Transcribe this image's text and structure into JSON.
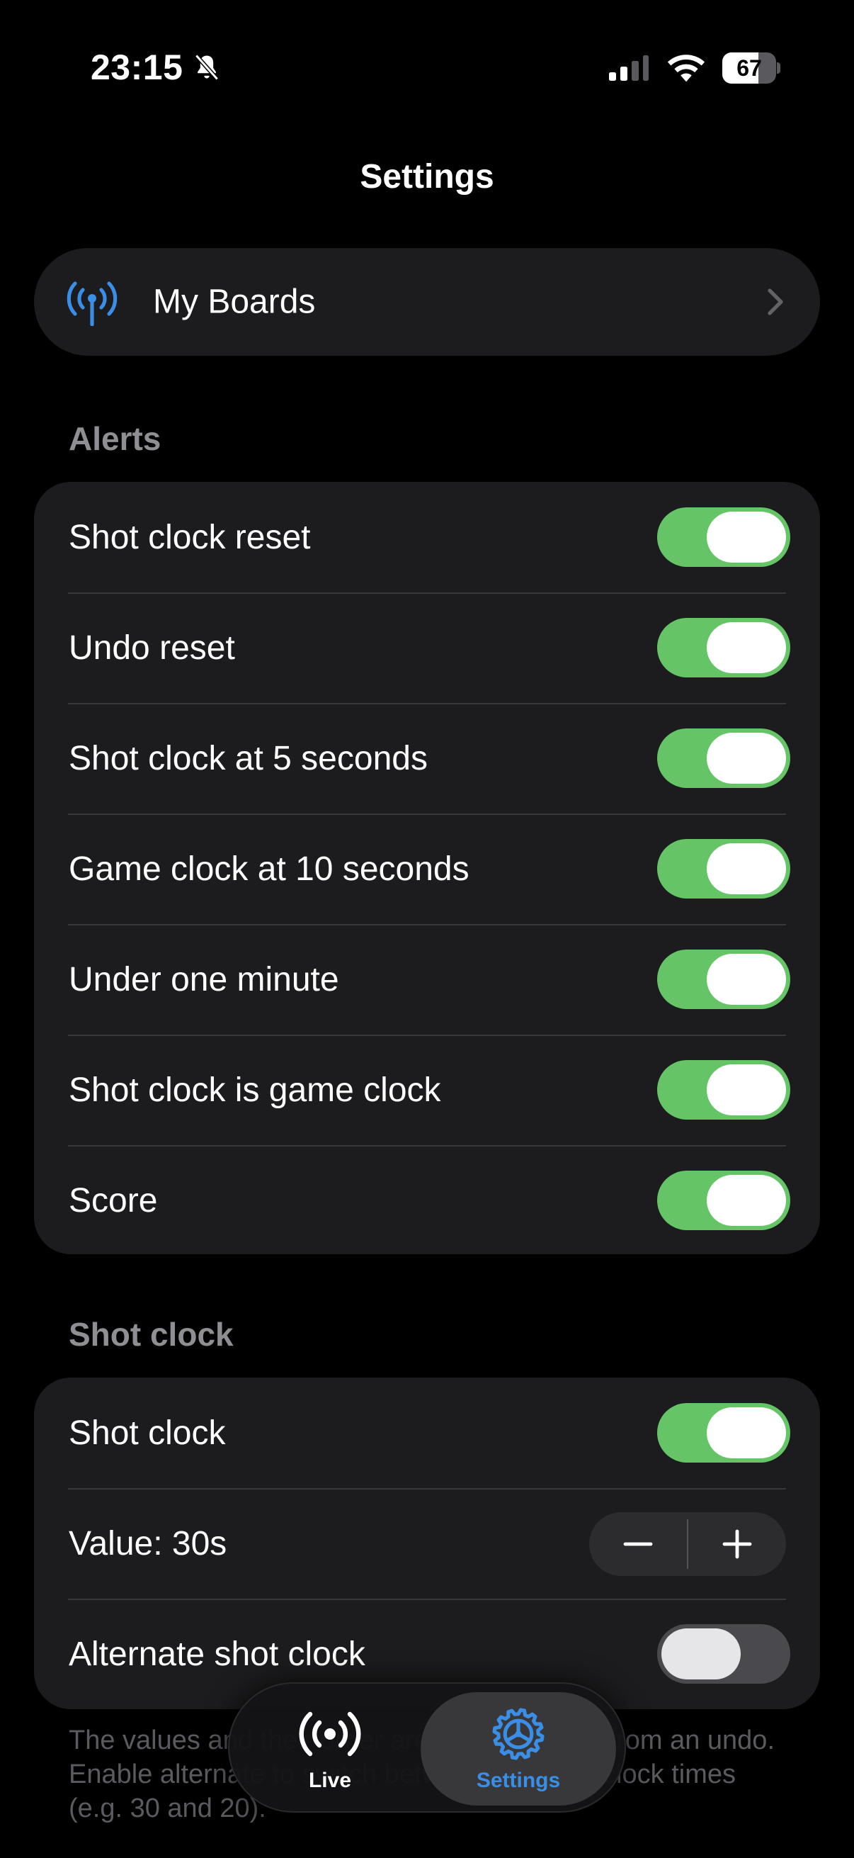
{
  "status_bar": {
    "time": "23:15",
    "battery_percent": 67,
    "battery_label": "67",
    "icons": [
      "bell-slash-icon",
      "cellular-signal-icon",
      "wifi-icon",
      "battery-icon"
    ]
  },
  "nav": {
    "title": "Settings"
  },
  "boards": {
    "label": "My Boards",
    "icon": "antenna-icon",
    "accent": "#3a8ee6"
  },
  "alerts": {
    "header": "Alerts",
    "items": [
      {
        "label": "Shot clock reset",
        "on": true
      },
      {
        "label": "Undo reset",
        "on": true
      },
      {
        "label": "Shot clock at 5 seconds",
        "on": true
      },
      {
        "label": "Game clock at 10 seconds",
        "on": true
      },
      {
        "label": "Under one minute",
        "on": true
      },
      {
        "label": "Shot clock is game clock",
        "on": true
      },
      {
        "label": "Score",
        "on": true
      }
    ]
  },
  "shot_clock": {
    "header": "Shot clock",
    "toggle_label": "Shot clock",
    "toggle_on": true,
    "value_label": "Value: 30s",
    "alternate_label": "Alternate shot clock",
    "alternate_on": false,
    "footer": "The values and their order are used for reset from an undo. Enable alternate to switch between two shot-clock times (e.g. 30 and 20)."
  },
  "tab_bar": {
    "tabs": [
      {
        "label": "Live",
        "icon": "broadcast-icon",
        "selected": false
      },
      {
        "label": "Settings",
        "icon": "gear-icon",
        "selected": true
      }
    ]
  },
  "colors": {
    "background": "#000000",
    "card": "#1c1c1e",
    "toggle_on": "#65c466",
    "toggle_off": "#4a4a4e",
    "accent": "#3a8ee6",
    "secondary_text": "#8e8e93"
  }
}
